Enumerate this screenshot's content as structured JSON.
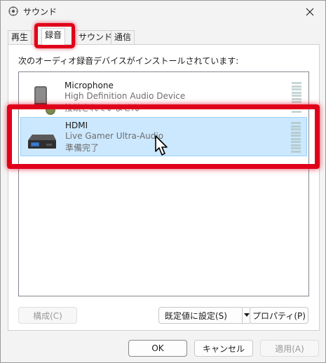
{
  "window": {
    "title": "サウンド"
  },
  "tabs": [
    {
      "label": "再生"
    },
    {
      "label": "録音"
    },
    {
      "label": "サウンド"
    },
    {
      "label": "通信"
    }
  ],
  "panel": {
    "instruction": "次のオーディオ録音デバイスがインストールされています:"
  },
  "devices": [
    {
      "name": "Microphone",
      "description": "High Definition Audio Device",
      "status": "接続されていません",
      "icon": "microphone-icon"
    },
    {
      "name": "HDMI",
      "description": "Live Gamer Ultra-Audio",
      "status": "準備完了",
      "icon": "capture-device-icon"
    }
  ],
  "buttons": {
    "configure": "構成(C)",
    "set_default": "既定値に設定(S)",
    "properties": "プロパティ(P)",
    "ok": "OK",
    "cancel": "キャンセル",
    "apply": "適用(A)"
  },
  "colors": {
    "accent_highlight": "#e0001a",
    "selected_row": "#cce8ff",
    "selected_border": "#99d1ff"
  }
}
